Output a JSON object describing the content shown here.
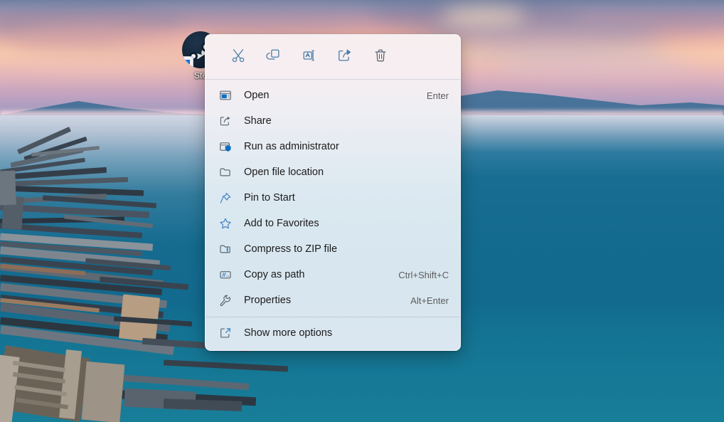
{
  "desktop": {
    "wallpaper_description": "Sunset over a lake with weathered wooden pier, pink clouds and blue mountains",
    "icon": {
      "name": "steam-shortcut",
      "label": "Ste",
      "full_label": "Steam",
      "badge": "shortcut-arrow"
    },
    "colors": {
      "sky_pink": "#f3bba8",
      "mountain_blue": "#3f6f96",
      "water_blue": "#126a8e",
      "water_teal": "#1c8ca3"
    }
  },
  "context_menu": {
    "toolbar": [
      {
        "name": "cut-icon",
        "tooltip": "Cut"
      },
      {
        "name": "copy-icon",
        "tooltip": "Copy"
      },
      {
        "name": "rename-icon",
        "tooltip": "Rename"
      },
      {
        "name": "share-icon",
        "tooltip": "Share"
      },
      {
        "name": "delete-icon",
        "tooltip": "Delete"
      }
    ],
    "items": [
      {
        "label": "Open",
        "accel": "Enter",
        "icon": "open-window-icon"
      },
      {
        "label": "Share",
        "accel": "",
        "icon": "share-box-icon"
      },
      {
        "label": "Run as administrator",
        "accel": "",
        "icon": "shield-admin-icon"
      },
      {
        "label": "Open file location",
        "accel": "",
        "icon": "folder-icon"
      },
      {
        "label": "Pin to Start",
        "accel": "",
        "icon": "pin-icon"
      },
      {
        "label": "Add to Favorites",
        "accel": "",
        "icon": "star-icon"
      },
      {
        "label": "Compress to ZIP file",
        "accel": "",
        "icon": "zip-folder-icon"
      },
      {
        "label": "Copy as path",
        "accel": "Ctrl+Shift+C",
        "icon": "copy-path-icon"
      },
      {
        "label": "Properties",
        "accel": "Alt+Enter",
        "icon": "wrench-icon"
      }
    ],
    "footer": {
      "label": "Show more options",
      "accel": "",
      "icon": "show-more-icon"
    },
    "accent_color": "#0c6fc4",
    "text_color": "#1b1b1b",
    "accel_color": "#5c5c5c"
  }
}
